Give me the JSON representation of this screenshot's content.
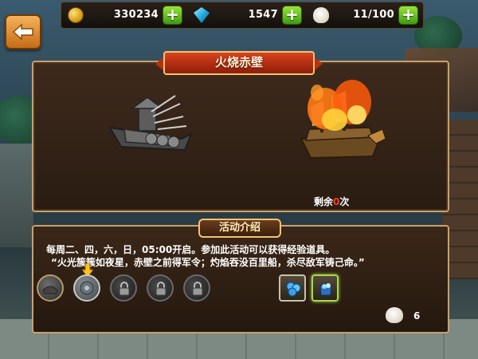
{
  "resources": {
    "gold": {
      "icon": "gold-coin-icon",
      "value": "330234",
      "add_icon": "plus-icon"
    },
    "gems": {
      "icon": "diamond-gem-icon",
      "value": "1547",
      "add_icon": "plus-icon"
    },
    "stamina": {
      "icon": "steamed-bun-icon",
      "value": "11/100",
      "add_icon": "plus-icon"
    }
  },
  "back_button": {
    "icon": "back-arrow-icon"
  },
  "event": {
    "title": "火烧赤壁",
    "remaining_prefix": "剩余",
    "remaining_count": "0",
    "remaining_suffix": "次"
  },
  "intro": {
    "heading": "活动介绍",
    "schedule": "每周二、四，六，日，05:00开启。参加此活动可以获得经验道具。",
    "poem": "“火光簇簇如夜星，赤壁之前得军令；灼焰吞没百里船，杀尽敌军铸己命。”"
  },
  "progress": {
    "stages": [
      {
        "state": "completed",
        "icon": "completed-stage-icon"
      },
      {
        "state": "current",
        "icon": "current-stage-icon"
      },
      {
        "state": "locked",
        "icon": "lock-icon"
      },
      {
        "state": "locked",
        "icon": "lock-icon"
      },
      {
        "state": "locked",
        "icon": "lock-icon"
      }
    ],
    "current_marker_icon": "down-arrow-icon"
  },
  "rewards": [
    {
      "icon": "blue-gem-cluster-icon",
      "selected": false
    },
    {
      "icon": "blue-gem-pouch-icon",
      "selected": true
    }
  ],
  "cost": {
    "icon": "steamed-bun-icon",
    "value": "6"
  },
  "colors": {
    "panel_border": "#c8a16b",
    "title_red": "#d8431e",
    "plus_green": "#3f9a12",
    "remaining_red": "#ff3b20"
  }
}
